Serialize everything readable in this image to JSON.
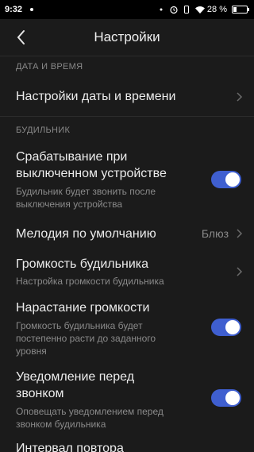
{
  "status": {
    "time": "9:32",
    "battery": "28 %",
    "battery_level": 0.28
  },
  "header": {
    "title": "Настройки"
  },
  "sections": {
    "datetime": {
      "header": "ДАТА И ВРЕМЯ",
      "item": "Настройки даты и времени"
    },
    "alarm": {
      "header": "БУДИЛЬНИК"
    }
  },
  "items": {
    "power_off": {
      "title_line1": "Срабатывание при",
      "title_line2": "выключенном устройстве",
      "sub_line1": "Будильник будет звонить после",
      "sub_line2": "выключения устройства",
      "enabled": true
    },
    "ringtone": {
      "title": "Мелодия по умолчанию",
      "value": "Блюз"
    },
    "volume": {
      "title": "Громкость будильника",
      "sub": "Настройка громкости будильника"
    },
    "ramp": {
      "title": "Нарастание громкости",
      "sub_line1": "Громкость будильника будет",
      "sub_line2": "постепенно расти до заданного",
      "sub_line3": "уровня",
      "enabled": true
    },
    "notify": {
      "title_line1": "Уведомление перед",
      "title_line2": "звонком",
      "sub_line1": "Оповещать уведомлением перед",
      "sub_line2": "звонком будильника",
      "enabled": true
    },
    "snooze": {
      "title": "Интервал повтора"
    }
  }
}
